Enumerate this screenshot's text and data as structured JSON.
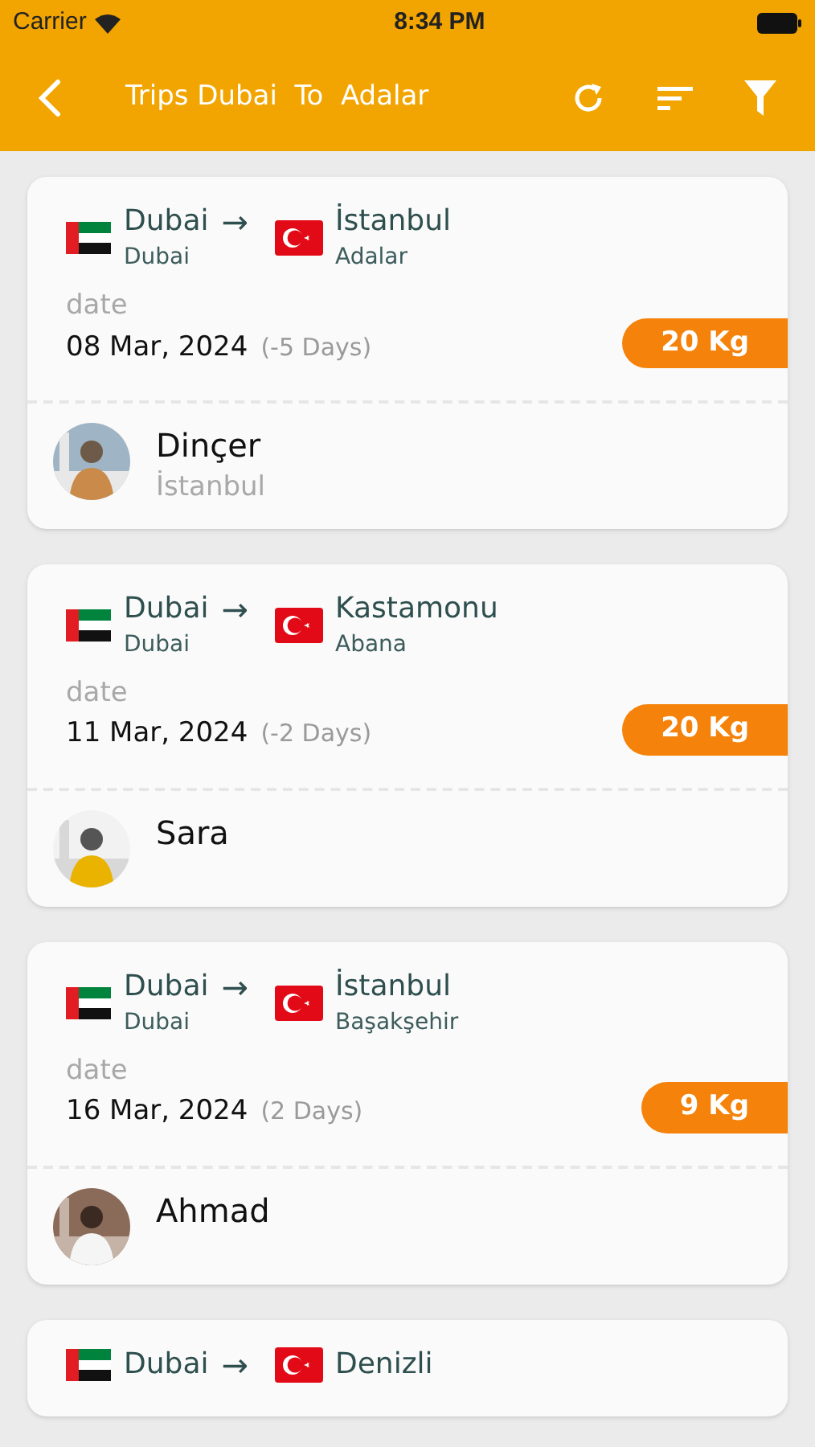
{
  "status_bar": {
    "carrier": "Carrier",
    "time": "8:34 PM"
  },
  "header": {
    "title": "Trips Dubai  To  Adalar"
  },
  "trips": [
    {
      "from": {
        "kind": "uae",
        "city": "Dubai",
        "area": "Dubai"
      },
      "arrow": "→",
      "to": {
        "kind": "turkey",
        "city": "İstanbul",
        "area": "Adalar"
      },
      "date_label": "date",
      "date": "08 Mar, 2024",
      "days": "(-5 Days)",
      "weight": "20 Kg",
      "traveler": {
        "name": "Dinçer",
        "city": "İstanbul"
      }
    },
    {
      "from": {
        "kind": "uae",
        "city": "Dubai",
        "area": "Dubai"
      },
      "arrow": "→",
      "to": {
        "kind": "turkey",
        "city": "Kastamonu",
        "area": "Abana"
      },
      "date_label": "date",
      "date": "11 Mar, 2024",
      "days": "(-2 Days)",
      "weight": "20 Kg",
      "traveler": {
        "name": "Sara"
      }
    },
    {
      "from": {
        "kind": "uae",
        "city": "Dubai",
        "area": "Dubai"
      },
      "arrow": "→",
      "to": {
        "kind": "turkey",
        "city": "İstanbul",
        "area": "Başakşehir"
      },
      "date_label": "date",
      "date": "16 Mar, 2024",
      "days": "(2 Days)",
      "weight": "9 Kg",
      "traveler": {
        "name": "Ahmad"
      }
    },
    {
      "from": {
        "kind": "uae",
        "city": "Dubai"
      },
      "arrow": "→",
      "to": {
        "kind": "turkey",
        "city": "Denizli"
      }
    }
  ]
}
